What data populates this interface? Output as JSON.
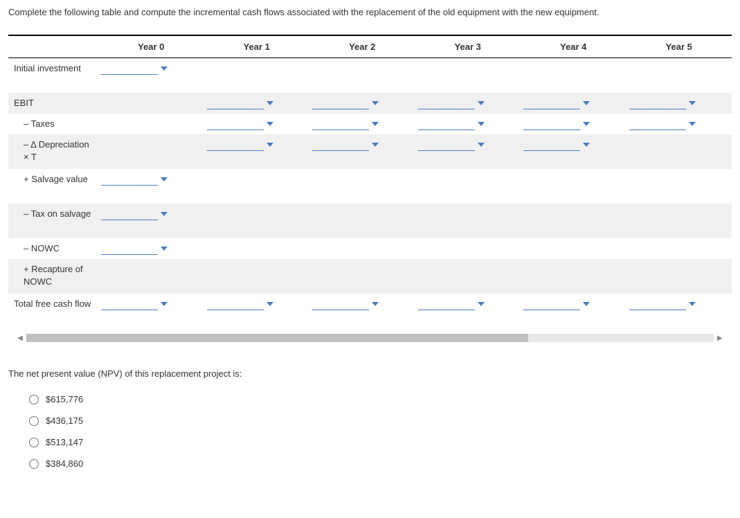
{
  "instruction": "Complete the following table and compute the incremental cash flows associated with the replacement of the old equipment with the new equipment.",
  "columns": [
    "",
    "Year 0",
    "Year 1",
    "Year 2",
    "Year 3",
    "Year 4",
    "Year 5"
  ],
  "rows": [
    {
      "label": "Initial investment",
      "shaded": false,
      "tall": true,
      "cells": [
        true,
        false,
        false,
        false,
        false,
        false
      ]
    },
    {
      "label": "EBIT",
      "shaded": true,
      "tall": false,
      "cells": [
        false,
        true,
        true,
        true,
        true,
        true
      ]
    },
    {
      "label": "– Taxes",
      "shaded": false,
      "tall": false,
      "indent": true,
      "cells": [
        false,
        true,
        true,
        true,
        true,
        true
      ]
    },
    {
      "label": "– Δ Depreciation × T",
      "shaded": true,
      "tall": true,
      "indent": true,
      "cells": [
        false,
        true,
        true,
        true,
        true,
        false
      ]
    },
    {
      "label": "+ Salvage value",
      "shaded": false,
      "tall": true,
      "indent": true,
      "cells": [
        true,
        false,
        false,
        false,
        false,
        false
      ]
    },
    {
      "label": "– Tax on salvage",
      "shaded": true,
      "tall": true,
      "indent": true,
      "cells": [
        true,
        false,
        false,
        false,
        false,
        false
      ]
    },
    {
      "label": "– NOWC",
      "shaded": false,
      "tall": false,
      "indent": true,
      "cells": [
        true,
        false,
        false,
        false,
        false,
        false
      ]
    },
    {
      "label": "+ Recapture of NOWC",
      "shaded": true,
      "tall": true,
      "indent": true,
      "cells": [
        false,
        false,
        false,
        false,
        false,
        false
      ]
    },
    {
      "label": "Total free cash flow",
      "shaded": false,
      "tall": true,
      "cells": [
        true,
        true,
        true,
        true,
        true,
        true
      ]
    }
  ],
  "npv_question": "The net present value (NPV) of this replacement project is:",
  "npv_options": [
    "$615,776",
    "$436,175",
    "$513,147",
    "$384,860"
  ]
}
